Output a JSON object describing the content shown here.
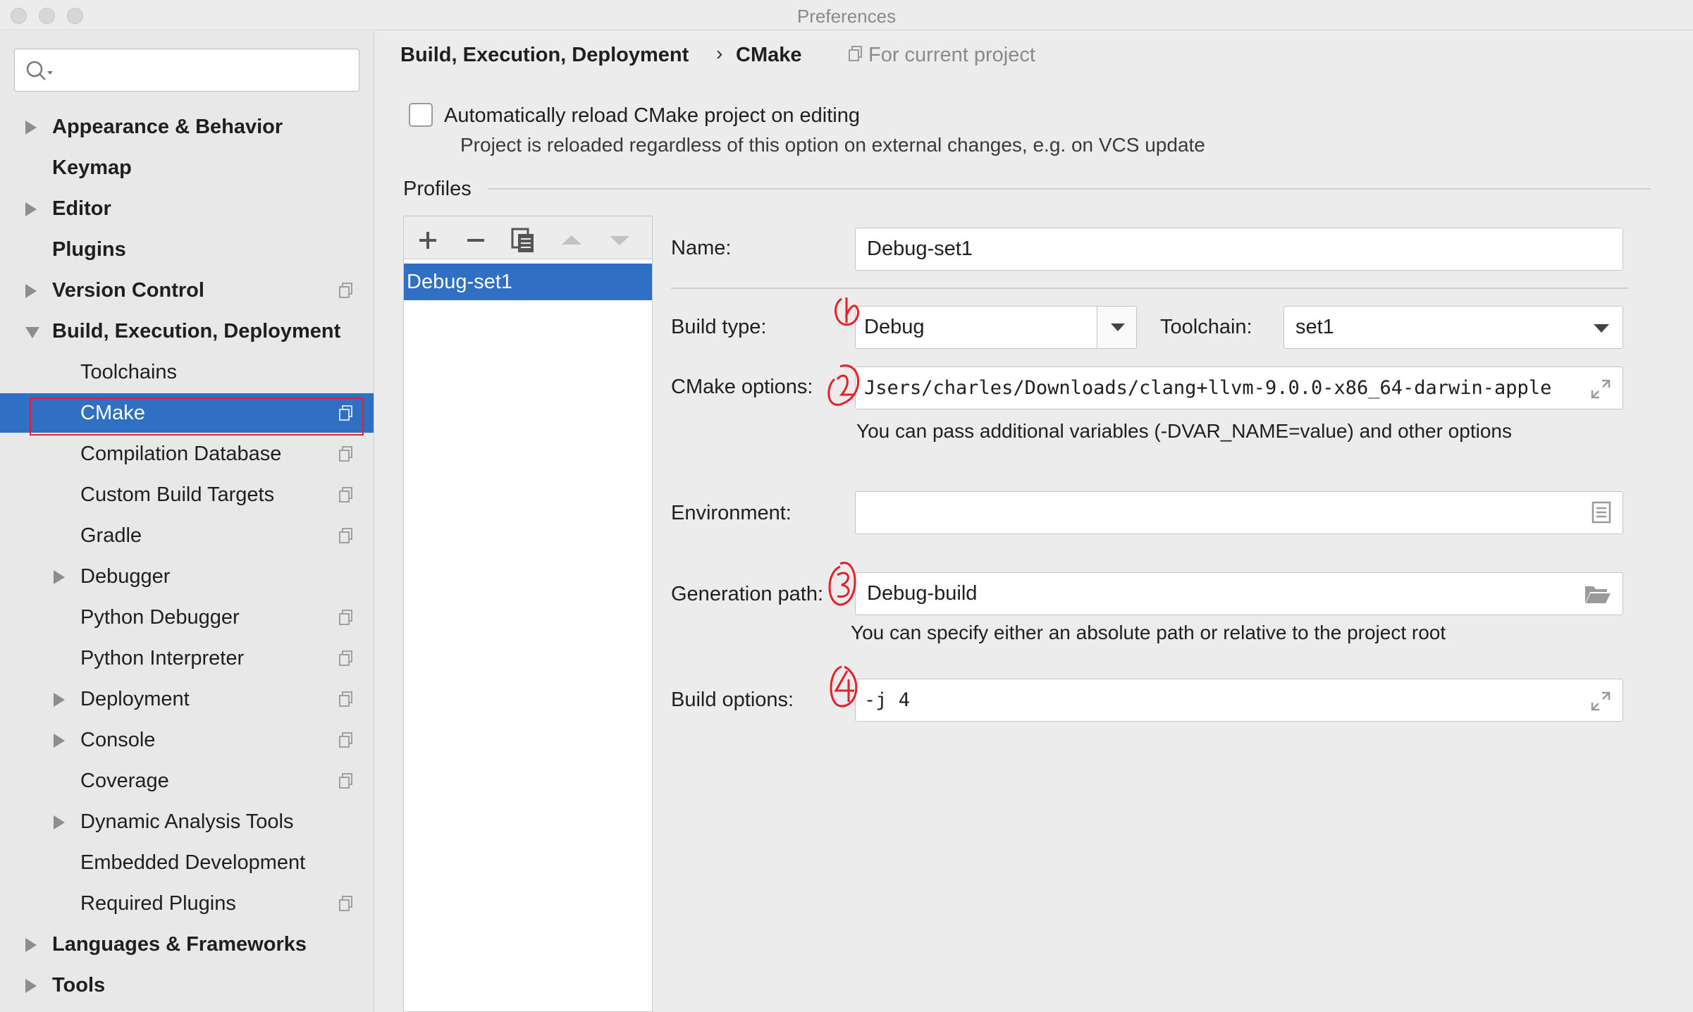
{
  "window": {
    "title": "Preferences"
  },
  "sidebar": {
    "search_placeholder": "",
    "items": [
      {
        "label": "Appearance & Behavior",
        "level": 0,
        "bold": true,
        "arrow": "right",
        "proj": false
      },
      {
        "label": "Keymap",
        "level": 0,
        "bold": true,
        "arrow": "",
        "proj": false
      },
      {
        "label": "Editor",
        "level": 0,
        "bold": true,
        "arrow": "right",
        "proj": false
      },
      {
        "label": "Plugins",
        "level": 0,
        "bold": true,
        "arrow": "",
        "proj": false
      },
      {
        "label": "Version Control",
        "level": 0,
        "bold": true,
        "arrow": "right",
        "proj": true
      },
      {
        "label": "Build, Execution, Deployment",
        "level": 0,
        "bold": true,
        "arrow": "down",
        "proj": false
      },
      {
        "label": "Toolchains",
        "level": 1,
        "bold": false,
        "arrow": "",
        "proj": false
      },
      {
        "label": "CMake",
        "level": 1,
        "bold": false,
        "arrow": "",
        "proj": true,
        "selected": true
      },
      {
        "label": "Compilation Database",
        "level": 1,
        "bold": false,
        "arrow": "",
        "proj": true
      },
      {
        "label": "Custom Build Targets",
        "level": 1,
        "bold": false,
        "arrow": "",
        "proj": true
      },
      {
        "label": "Gradle",
        "level": 1,
        "bold": false,
        "arrow": "",
        "proj": true
      },
      {
        "label": "Debugger",
        "level": 1,
        "bold": false,
        "arrow": "right",
        "proj": false
      },
      {
        "label": "Python Debugger",
        "level": 1,
        "bold": false,
        "arrow": "",
        "proj": true
      },
      {
        "label": "Python Interpreter",
        "level": 1,
        "bold": false,
        "arrow": "",
        "proj": true
      },
      {
        "label": "Deployment",
        "level": 1,
        "bold": false,
        "arrow": "right",
        "proj": true
      },
      {
        "label": "Console",
        "level": 1,
        "bold": false,
        "arrow": "right",
        "proj": true
      },
      {
        "label": "Coverage",
        "level": 1,
        "bold": false,
        "arrow": "",
        "proj": true
      },
      {
        "label": "Dynamic Analysis Tools",
        "level": 1,
        "bold": false,
        "arrow": "right",
        "proj": false
      },
      {
        "label": "Embedded Development",
        "level": 1,
        "bold": false,
        "arrow": "",
        "proj": false
      },
      {
        "label": "Required Plugins",
        "level": 1,
        "bold": false,
        "arrow": "",
        "proj": true
      },
      {
        "label": "Languages & Frameworks",
        "level": 0,
        "bold": true,
        "arrow": "right",
        "proj": false
      },
      {
        "label": "Tools",
        "level": 0,
        "bold": true,
        "arrow": "right",
        "proj": false
      }
    ]
  },
  "breadcrumb": {
    "parent": "Build, Execution, Deployment",
    "separator": "›",
    "current": "CMake",
    "scope": "For current project"
  },
  "auto_reload": {
    "label": "Automatically reload CMake project on editing",
    "checked": false,
    "hint": "Project is reloaded regardless of this option on external changes, e.g. on VCS update"
  },
  "profiles": {
    "section_label": "Profiles",
    "toolbar": [
      "add-icon",
      "remove-icon",
      "copy-icon",
      "move-up-icon",
      "move-down-icon"
    ],
    "items": [
      "Debug-set1"
    ]
  },
  "form": {
    "name_label": "Name:",
    "name_value": "Debug-set1",
    "build_type_label": "Build type:",
    "build_type_value": "Debug",
    "toolchain_label": "Toolchain:",
    "toolchain_value": "set1",
    "cmake_options_label": "CMake options:",
    "cmake_options_value": "Jsers/charles/Downloads/clang+llvm-9.0.0-x86_64-darwin-apple",
    "cmake_options_hint": "You can pass additional variables (-DVAR_NAME=value) and other options",
    "environment_label": "Environment:",
    "environment_value": "",
    "generation_path_label": "Generation path:",
    "generation_path_value": "Debug-build",
    "generation_path_hint": "You can specify either an absolute path or relative to the project root",
    "build_options_label": "Build options:",
    "build_options_value": "-j 4"
  },
  "annotations": {
    "color": "#e5202a",
    "marks": [
      "1",
      "2",
      "3",
      "4"
    ]
  },
  "colors": {
    "selection": "#2f6fc4",
    "annotation": "#e5202a"
  }
}
